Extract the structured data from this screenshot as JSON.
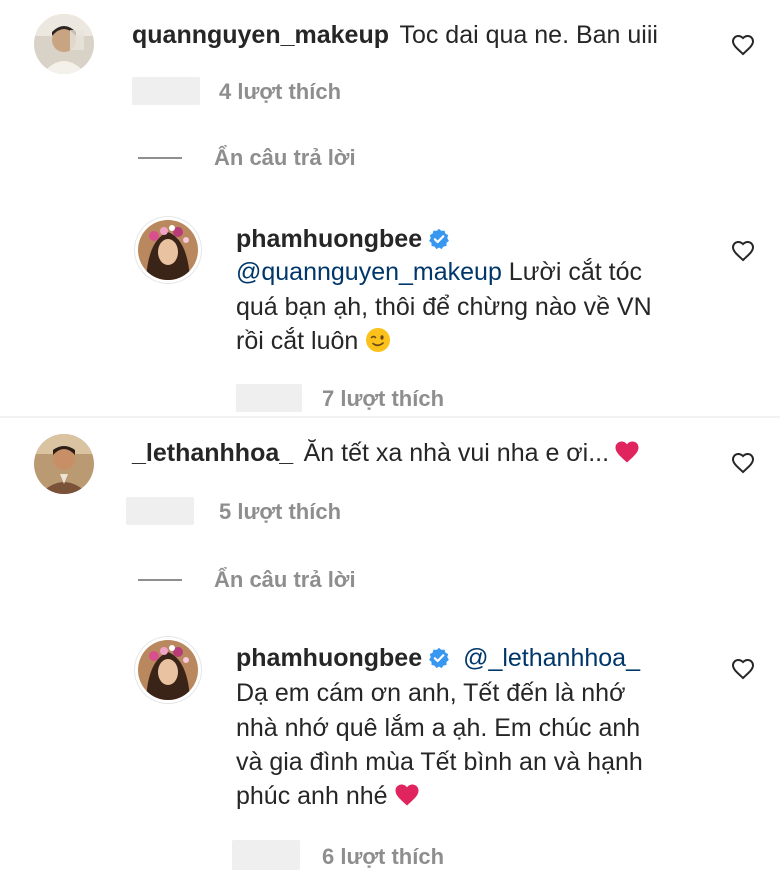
{
  "comments": [
    {
      "username": "quannguyen_makeup",
      "text": "Toc dai qua ne. Ban uiii",
      "likes": "4 lượt thích",
      "hide_replies": "Ẩn câu trả lời",
      "reply": {
        "username": "phamhuongbee",
        "mention": "@quannguyen_makeup",
        "line1_rest": " Lười cắt tóc",
        "line2": "quá bạn ạh, thôi để chừng nào về VN",
        "line3": "rồi cắt luôn",
        "likes": "7 lượt thích"
      }
    },
    {
      "username": "_lethanhhoa_",
      "text": "Ăn tết xa nhà vui nha e ơi...",
      "likes": "5 lượt thích",
      "hide_replies": "Ẩn câu trả lời",
      "reply": {
        "username": "phamhuongbee",
        "mention": "@_lethanhhoa_",
        "line1": "Dạ em cám ơn anh, Tết đến là nhớ",
        "line2": "nhà nhớ quê lắm a ạh. Em chúc anh",
        "line3": "và gia đình mùa Tết bình an và hạnh",
        "line4": "phúc anh nhé",
        "likes": "6 lượt thích"
      }
    }
  ],
  "colors": {
    "text": "#262626",
    "secondary": "#8e8e8e",
    "mention": "#00376b",
    "verified": "#3897f0",
    "heart_emoji": "#e0245e"
  },
  "icons": [
    "heart-outline-icon",
    "verified-badge-icon",
    "red-heart-emoji",
    "wink-emoji"
  ]
}
